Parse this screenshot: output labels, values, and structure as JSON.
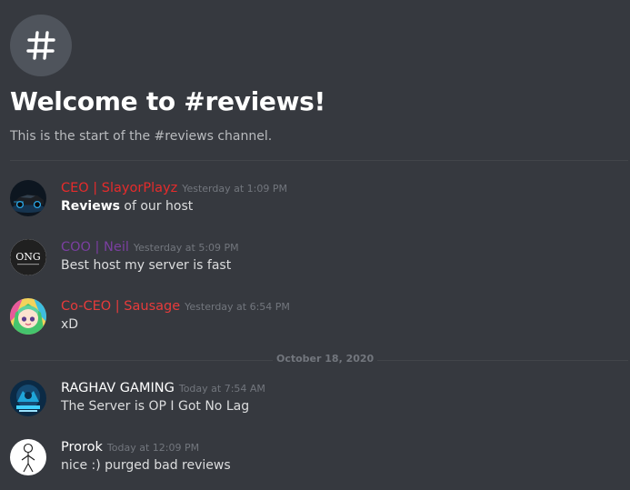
{
  "colors": {
    "background": "#36393f",
    "ceo": "#e62b2b",
    "coo": "#7b3fa0",
    "co_ceo": "#e73b3b",
    "default_author": "#ffffff",
    "timestamp": "#72767d"
  },
  "channel": {
    "icon": "hash-icon",
    "welcome_title": "Welcome to #reviews!",
    "welcome_subtitle": "This is the start of the #reviews channel."
  },
  "messages": [
    {
      "author": "CEO | SlayorPlayz",
      "timestamp": "Yesterday at 1:09 PM",
      "text_bold": "Reviews",
      "text_rest": " of our host",
      "avatar": "car-avatar"
    },
    {
      "author": "COO | Neil",
      "timestamp": "Yesterday at 5:09 PM",
      "text": "Best host my server is fast",
      "avatar": "ong-logo-avatar",
      "avatar_text": "ONG"
    },
    {
      "author": "Co-CEO | Sausage",
      "timestamp": "Yesterday at 6:54 PM",
      "text": "xD",
      "avatar": "anime-girl-avatar"
    },
    {
      "author": "RAGHAV GAMING",
      "timestamp": "Today at 7:54 AM",
      "text": "The Server is OP I Got No Lag",
      "avatar": "gaming-logo-avatar"
    },
    {
      "author": "Prorok",
      "timestamp": "Today at 12:09 PM",
      "text": "nice :) purged bad reviews",
      "avatar": "stick-figure-avatar"
    }
  ],
  "date_divider": "October 18, 2020"
}
